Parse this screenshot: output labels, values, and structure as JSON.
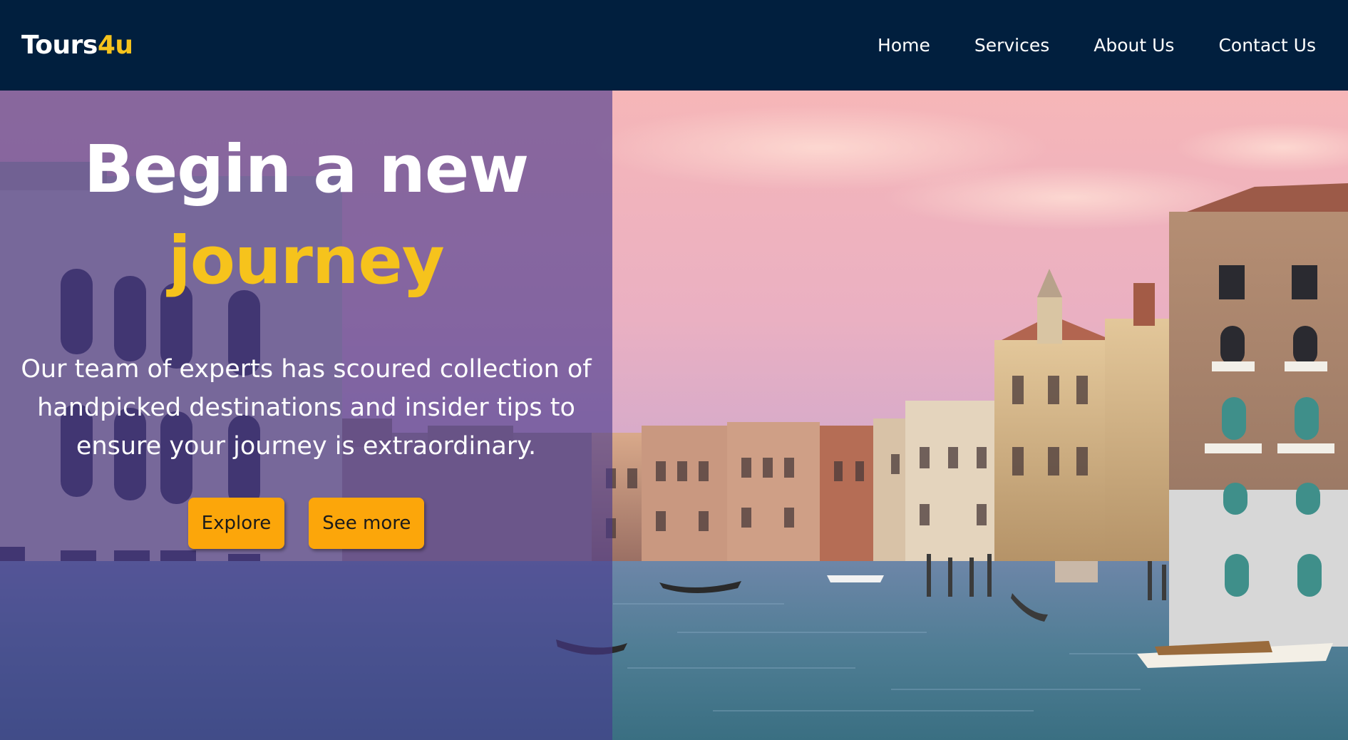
{
  "brand": {
    "name_main": "Tours",
    "name_accent": "4u",
    "accent_color": "#f6c31c",
    "nav_bg": "#011f3e"
  },
  "nav": {
    "items": [
      {
        "label": "Home"
      },
      {
        "label": "Services"
      },
      {
        "label": "About Us"
      },
      {
        "label": "Contact Us"
      }
    ]
  },
  "hero": {
    "headline_line1": "Begin a new",
    "headline_line2": "journey",
    "tagline": "Our team of experts has scoured collection of handpicked destinations and insider tips to ensure your journey is extraordinary.",
    "primary_button": "Explore",
    "secondary_button": "See more",
    "button_color": "#fca60a",
    "overlay_color": "#46378c"
  }
}
